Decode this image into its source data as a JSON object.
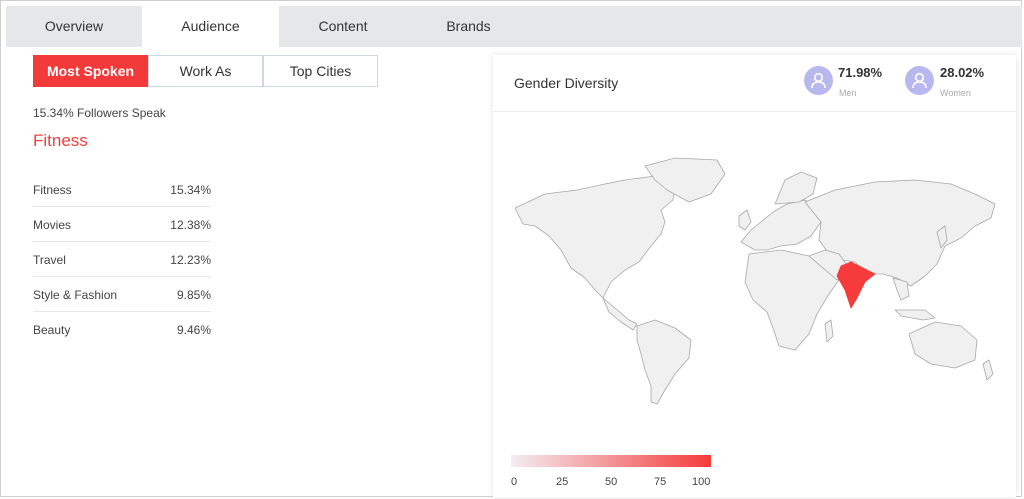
{
  "tabs": [
    "Overview",
    "Audience",
    "Content",
    "Brands"
  ],
  "segments": [
    "Most Spoken",
    "Work As",
    "Top Cities"
  ],
  "summary": "15.34% Followers Speak",
  "top_item": "Fitness",
  "rows": [
    {
      "name": "Fitness",
      "value": "15.34%"
    },
    {
      "name": "Movies",
      "value": "12.38%"
    },
    {
      "name": "Travel",
      "value": "12.23%"
    },
    {
      "name": "Style & Fashion",
      "value": "9.85%"
    },
    {
      "name": "Beauty",
      "value": "9.46%"
    }
  ],
  "gender": {
    "title": "Gender Diversity",
    "men_pct": "71.98%",
    "men_label": "Men",
    "women_pct": "28.02%",
    "women_label": "Women"
  },
  "map": {
    "highlight_country": "India",
    "highlight_color": "#f53b3b",
    "base_color": "#f0f0f0",
    "legend_ticks": [
      "0",
      "25",
      "50",
      "75",
      "100"
    ]
  },
  "colors": {
    "accent": "#f33a3a",
    "avatar": "#b9b8ee",
    "tabbar": "#e6e7ea"
  }
}
